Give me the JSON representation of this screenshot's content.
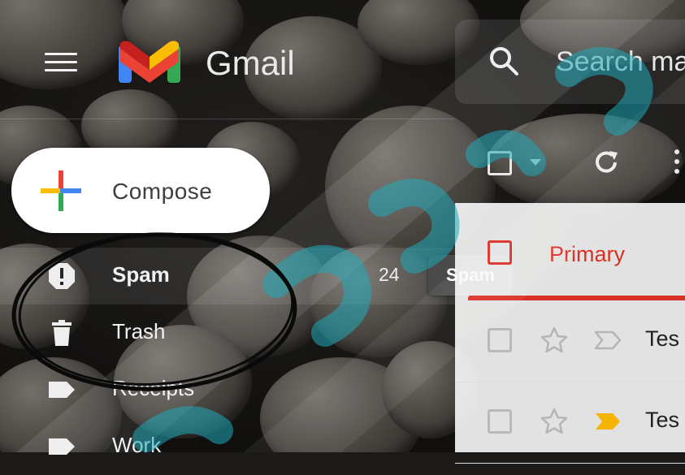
{
  "header": {
    "app_title": "Gmail",
    "menu_icon": "hamburger-menu-icon",
    "logo_icon": "gmail-m-logo-icon",
    "search": {
      "placeholder": "Search mail",
      "icon": "search-icon"
    }
  },
  "compose": {
    "label": "Compose",
    "icon": "multicolor-plus-icon"
  },
  "nav": {
    "items": [
      {
        "label": "Spam",
        "icon": "spam-exclamation-icon",
        "count": "24",
        "active": true
      },
      {
        "label": "Trash",
        "icon": "trash-icon",
        "count": "",
        "active": false
      },
      {
        "label": "Receipts",
        "icon": "label-icon",
        "count": "",
        "active": false
      },
      {
        "label": "Work",
        "icon": "label-icon",
        "count": "",
        "active": false
      }
    ],
    "tooltip": "Spam"
  },
  "toolbar": {
    "select_icon": "checkbox-icon",
    "dropdown_icon": "caret-down-icon",
    "refresh_icon": "refresh-icon",
    "more_icon": "more-vertical-icon"
  },
  "tabs": [
    {
      "label": "Primary",
      "icon": "inbox-icon",
      "selected": true
    }
  ],
  "emails": [
    {
      "sender": "Tes",
      "starred": false,
      "important": false
    },
    {
      "sender": "Tes",
      "starred": false,
      "important": true
    }
  ],
  "colors": {
    "accent_red": "#d93025",
    "important_yellow": "#f4b400",
    "google_blue": "#4285f4",
    "google_red": "#ea4335",
    "google_yellow": "#fbbc04",
    "google_green": "#34a853",
    "watermark_teal": "#1fa9b9"
  }
}
